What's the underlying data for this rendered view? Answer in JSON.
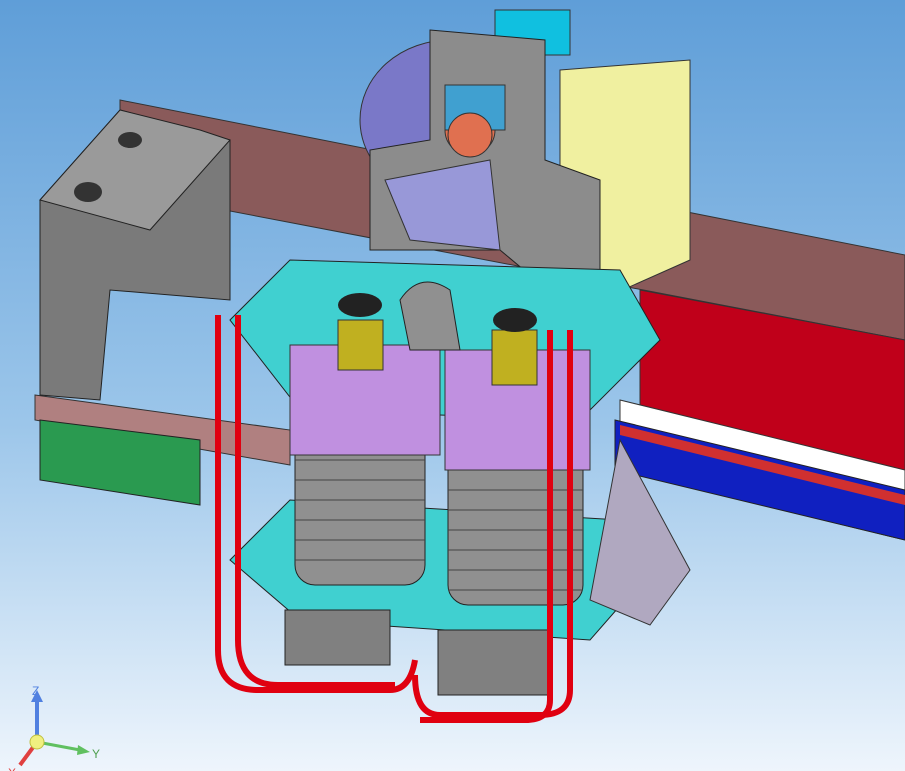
{
  "viewport": {
    "axis_triad": {
      "z_label": "Z",
      "y_label": "Y",
      "x_label": "X"
    },
    "colors": {
      "background_top": "#5f9ed8",
      "background_bottom": "#eef5fc",
      "rail": "#8a5a5a",
      "red_part": "#c0001a",
      "blue_rack": "#1020c0",
      "cyan_plate": "#40d0d0",
      "violet_block": "#c090e0",
      "gray_body": "#808080",
      "yellow_part": "#f0f0a0",
      "heat_pipe": "#e00010"
    }
  }
}
